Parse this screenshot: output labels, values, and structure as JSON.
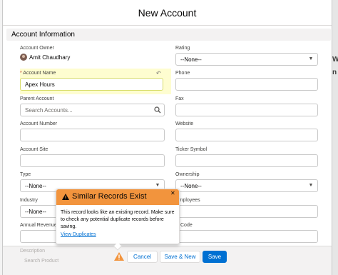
{
  "modal": {
    "title": "New Account"
  },
  "section": {
    "title": "Account Information"
  },
  "background": {
    "right_text_1": "W",
    "right_text_2": "n"
  },
  "left": {
    "owner_label": "Account Owner",
    "owner_name": "Amit Chaudhary",
    "name_required": "*",
    "name_label": "Account Name",
    "name_value": "Apex Hours",
    "parent_label": "Parent Account",
    "parent_placeholder": "Search Accounts...",
    "number_label": "Account Number",
    "site_label": "Account Site",
    "type_label": "Type",
    "type_value": "--None--",
    "industry_label": "Industry",
    "industry_value": "--None--",
    "revenue_label": "Annual Revenue"
  },
  "right": {
    "rating_label": "Rating",
    "rating_value": "--None--",
    "phone_label": "Phone",
    "fax_label": "Fax",
    "website_label": "Website",
    "ticker_label": "Ticker Symbol",
    "ownership_label": "Ownership",
    "ownership_value": "--None--",
    "employees_label": "Employees",
    "sic_label": "C Code"
  },
  "footer": {
    "faded_label": "Description",
    "faded_value": "Search Product",
    "cancel_label": "Cancel",
    "save_new_label": "Save & New",
    "save_label": "Save"
  },
  "popover": {
    "title": "Similar Records Exist",
    "body": "This record looks like an existing record. Make sure to check any potential duplicate records before saving.",
    "link": "View Duplicates"
  },
  "colors": {
    "brand": "#0070d2",
    "warning": "#f2943d",
    "highlight": "#fefdd0"
  }
}
